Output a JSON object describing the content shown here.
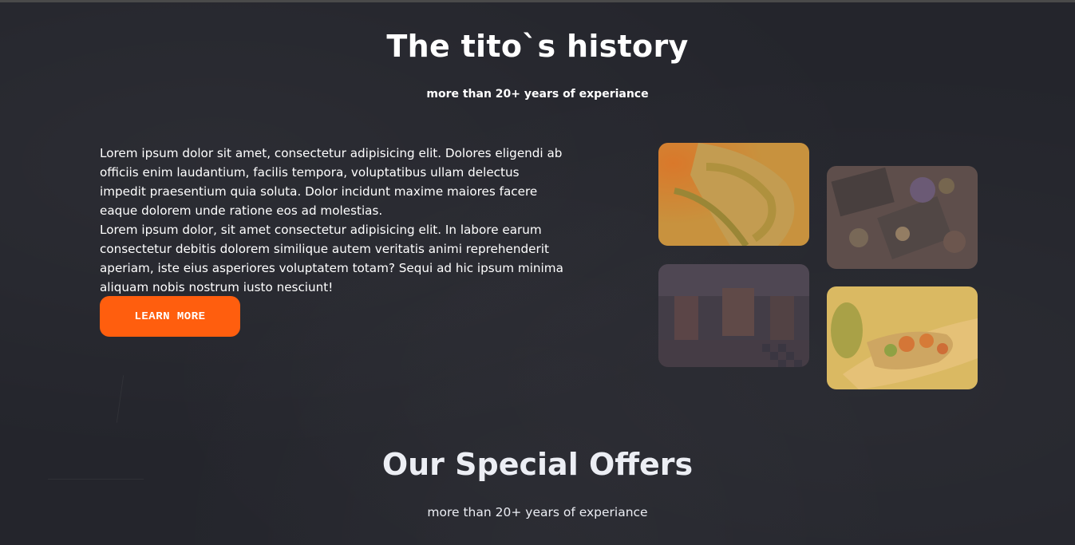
{
  "history": {
    "title": "The tito`s history",
    "subtitle": "more than 20+ years of experiance",
    "text": "Lorem ipsum dolor sit amet, consectetur adipisicing elit. Dolores eligendi ab officiis enim laudantium, facilis tempora, voluptatibus ullam delectus impedit praesentium quia soluta. Dolor incidunt maxime maiores facere eaque dolorem unde ratione eos ad molestias.\nLorem ipsum dolor, sit amet consectetur adipisicing elit. In labore earum consectetur debitis dolorem similique autem veritatis animi reprehenderit aperiam, iste eius asperiores voluptatem totam? Sequi ad hic ipsum minima aliquam nobis nostrum iusto nesciunt!",
    "button_label": "LEARN MORE"
  },
  "offers": {
    "title": "Our Special Offers",
    "subtitle": "more than 20+ years of experiance"
  },
  "colors": {
    "background": "#24252c",
    "accent": "#ff5e0e",
    "text": "#ffffff"
  }
}
